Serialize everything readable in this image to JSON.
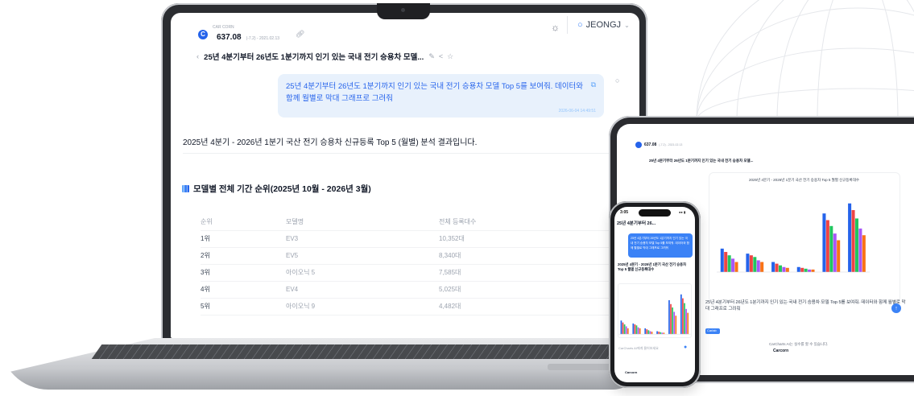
{
  "laptop": {
    "app": {
      "name": "CAR CORN",
      "price": "637.08",
      "price_meta": "(-7.2) - 2021.02.13",
      "user_name": "JEONGJ"
    },
    "conversation_title": "25년 4분기부터 26년도 1분기까지 인기 있는 국내 전기 승용차 모델...",
    "user_message": {
      "text": "25년 4분기부터 26년도 1분기까지 인기 있는 국내 전기 승용차 모델 Top 5를 보여줘. 데이터와 함께 월별로 막대 그래프로 그려줘",
      "timestamp": "2026-06-04 14:49:51"
    },
    "answer_intro": "2025년 4분기 - 2026년 1분기 국산 전기 승용차 신규등록 Top 5 (월별) 분석 결과입니다.",
    "section_title": "모델별 전체 기간 순위(2025년 10월 - 2026년 3월)",
    "table": {
      "headers": [
        "순위",
        "모델명",
        "전체 등록대수"
      ],
      "rows": [
        [
          "1위",
          "EV3",
          "10,352대"
        ],
        [
          "2위",
          "EV5",
          "8,340대"
        ],
        [
          "3위",
          "아이오닉 5",
          "7,585대"
        ],
        [
          "4위",
          "EV4",
          "5,025대"
        ],
        [
          "5위",
          "아이오닉 9",
          "4,482대"
        ]
      ]
    }
  },
  "tablet": {
    "price": "637.08",
    "price_meta": "(-7.2) - 2021.02.13",
    "conversation_title": "25년 4분기부터 26년도 1분기까지 인기 있는 국내 전기 승용차 모델...",
    "chart_title": "2025년 4분기 - 2026년 1분기 국산 전기 승용차 Top 5 월별 신규등록대수",
    "input_text": "25년 4분기부터 26년도 1분기까지 인기 있는 국내 전기 승용차 모델 Top 5를 보여줘. 데이터와 함께 월별로 막대 그래프로 그려줘",
    "footer_note": "CarCharts AI는 실수를 할 수 있습니다.",
    "brand": "Carcorn",
    "badge": "Carlab"
  },
  "phone": {
    "time": "3:05",
    "title": "25년 4분기부터 26...",
    "bubble_text": "25년 4분기부터 26년도 1분기까지 인기 있는 국내 전기 승용차 모델 Top 5를 보여줘. 데이터와 함께 월별로 막대 그래프로 그려줘",
    "answer": "2025년 4분기 - 2026년 1분기 국산 전기 승용차 Top 5 월별 신규등록대수",
    "input_placeholder": "CarCharts AI에게 물어보세요",
    "brand": "Carcorn"
  },
  "colors": {
    "accent": "#3b82f6",
    "series": [
      "#2563eb",
      "#ef4444",
      "#22c55e",
      "#a855f7",
      "#f97316",
      "#06b6d4"
    ]
  },
  "tablet_chart_series": [
    [
      0.28,
      0.22,
      0.12,
      0.06,
      0.7,
      0.82
    ],
    [
      0.24,
      0.2,
      0.1,
      0.05,
      0.62,
      0.74
    ],
    [
      0.2,
      0.18,
      0.08,
      0.04,
      0.55,
      0.64
    ],
    [
      0.16,
      0.14,
      0.06,
      0.03,
      0.46,
      0.52
    ],
    [
      0.12,
      0.12,
      0.05,
      0.03,
      0.38,
      0.44
    ]
  ]
}
